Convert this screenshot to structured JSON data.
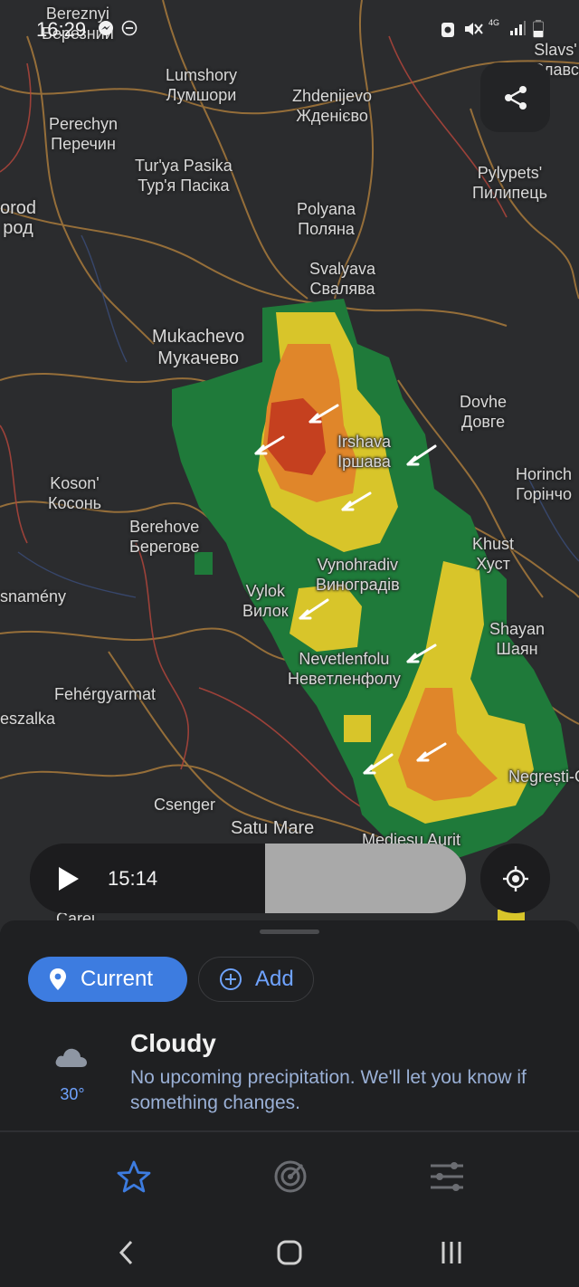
{
  "status_bar": {
    "time": "16:29",
    "network": "4G"
  },
  "map": {
    "cities": [
      {
        "latin": "Bereznyi",
        "cyrillic": "Березний"
      },
      {
        "latin": "Lumshory",
        "cyrillic": "Лумшори"
      },
      {
        "latin": "Zhdenijevo",
        "cyrillic": "Жденієво"
      },
      {
        "latin": "Slavs'",
        "cyrillic": "Славс"
      },
      {
        "latin": "Perechyn",
        "cyrillic": "Перечин"
      },
      {
        "latin": "Tur'ya Pasika",
        "cyrillic": "Тур'я Пасіка"
      },
      {
        "latin": "Pylypets'",
        "cyrillic": "Пилипець"
      },
      {
        "latin": "orod",
        "cyrillic": "род"
      },
      {
        "latin": "Polyana",
        "cyrillic": "Поляна"
      },
      {
        "latin": "Svalyava",
        "cyrillic": "Свалява"
      },
      {
        "latin": "Mukachevo",
        "cyrillic": "Мукачево"
      },
      {
        "latin": "Dovhe",
        "cyrillic": "Довге"
      },
      {
        "latin": "Irshava",
        "cyrillic": "Іршава"
      },
      {
        "latin": "Koson'",
        "cyrillic": "Косонь"
      },
      {
        "latin": "Horinch",
        "cyrillic": "Горінчо"
      },
      {
        "latin": "Berehove",
        "cyrillic": "Берегове"
      },
      {
        "latin": "Khust",
        "cyrillic": "Хуст"
      },
      {
        "latin": "Vynohradiv",
        "cyrillic": "Виноградів"
      },
      {
        "latin": "snamény",
        "cyrillic": ""
      },
      {
        "latin": "Vylok",
        "cyrillic": "Вилок"
      },
      {
        "latin": "Shayan",
        "cyrillic": "Шаян"
      },
      {
        "latin": "Nevetlenfolu",
        "cyrillic": "Невeтленфолу"
      },
      {
        "latin": "Fehérgyarmat",
        "cyrillic": ""
      },
      {
        "latin": "eszalka",
        "cyrillic": ""
      },
      {
        "latin": "Negrești-O",
        "cyrillic": ""
      },
      {
        "latin": "Csenger",
        "cyrillic": ""
      },
      {
        "latin": "Satu Mare",
        "cyrillic": ""
      },
      {
        "latin": "Mediesu Aurit",
        "cyrillic": ""
      },
      {
        "latin": "Carei",
        "cyrillic": ""
      }
    ]
  },
  "player": {
    "time": "15:14",
    "progress_fraction": 0.46
  },
  "sheet": {
    "chips": {
      "current": "Current",
      "add": "Add"
    },
    "weather": {
      "temperature": "30°",
      "condition": "Cloudy",
      "forecast": "No upcoming precipitation. We'll let you know if something changes."
    }
  },
  "colors": {
    "accent": "#3d7ce0",
    "accent_text": "#6fa3ff",
    "radar_green": "#1f7a3a",
    "radar_yellow": "#d8c52a",
    "radar_orange": "#e0862a",
    "radar_red": "#c5401f"
  },
  "icons": {
    "share": "share-icon",
    "play": "play-icon",
    "locate": "crosshair-icon",
    "location_pin": "location-pin-icon",
    "add": "add-circle-icon",
    "weather": "cloud-icon",
    "tab_favorites": "star-icon",
    "tab_radar": "radar-icon",
    "tab_settings": "sliders-icon"
  }
}
